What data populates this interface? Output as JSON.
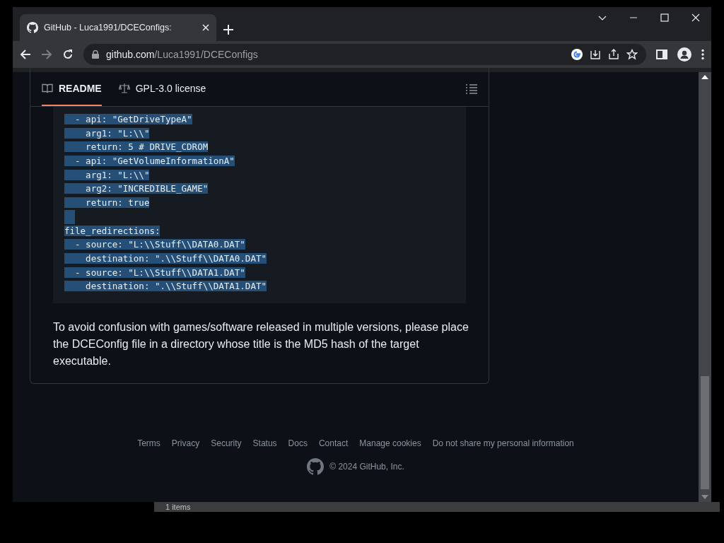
{
  "browser": {
    "tab": {
      "title": "GitHub - Luca1991/DCEConfigs:",
      "selected": true
    },
    "address": {
      "host": "github.com",
      "path": "/Luca1991/DCEConfigs"
    }
  },
  "readme": {
    "tabs": [
      {
        "label": "README",
        "selected": true
      },
      {
        "label": "GPL-3.0 license",
        "selected": false
      }
    ],
    "code_lines": [
      {
        "text": "  - api: \"GetDriveTypeA\"",
        "selected": true
      },
      {
        "text": "    arg1: \"L:\\\\\"",
        "selected": true
      },
      {
        "text": "    return: 5 # DRIVE_CDROM",
        "selected": true
      },
      {
        "text": "  - api: \"GetVolumeInformationA\"",
        "selected": true
      },
      {
        "text": "    arg1: \"L:\\\\\"",
        "selected": true
      },
      {
        "text": "    arg2: \"INCREDIBLE_GAME\"",
        "selected": true
      },
      {
        "text": "    return: true",
        "selected": true
      },
      {
        "kind": "blank",
        "selected": true
      },
      {
        "text": "file_redirections:",
        "selected": true
      },
      {
        "text": "  - source: \"L:\\\\Stuff\\\\DATA0.DAT\"",
        "selected": true
      },
      {
        "text": "    destination: \".\\\\Stuff\\\\DATA0.DAT\"",
        "selected": true
      },
      {
        "text": "  - source: \"L:\\\\Stuff\\\\DATA1.DAT\"",
        "selected": true
      },
      {
        "text": "    destination: \".\\\\Stuff\\\\DATA1.DAT\"",
        "selected": true
      }
    ],
    "paragraph": "To avoid confusion with games/software released in multiple versions, please place the DCEConfig file in a directory whose title is the MD5 hash of the target executable."
  },
  "footer": {
    "links": [
      "Terms",
      "Privacy",
      "Security",
      "Status",
      "Docs",
      "Contact",
      "Manage cookies",
      "Do not share my personal information"
    ],
    "copyright": "© 2024 GitHub, Inc."
  },
  "background_window": {
    "status": "1 items"
  }
}
